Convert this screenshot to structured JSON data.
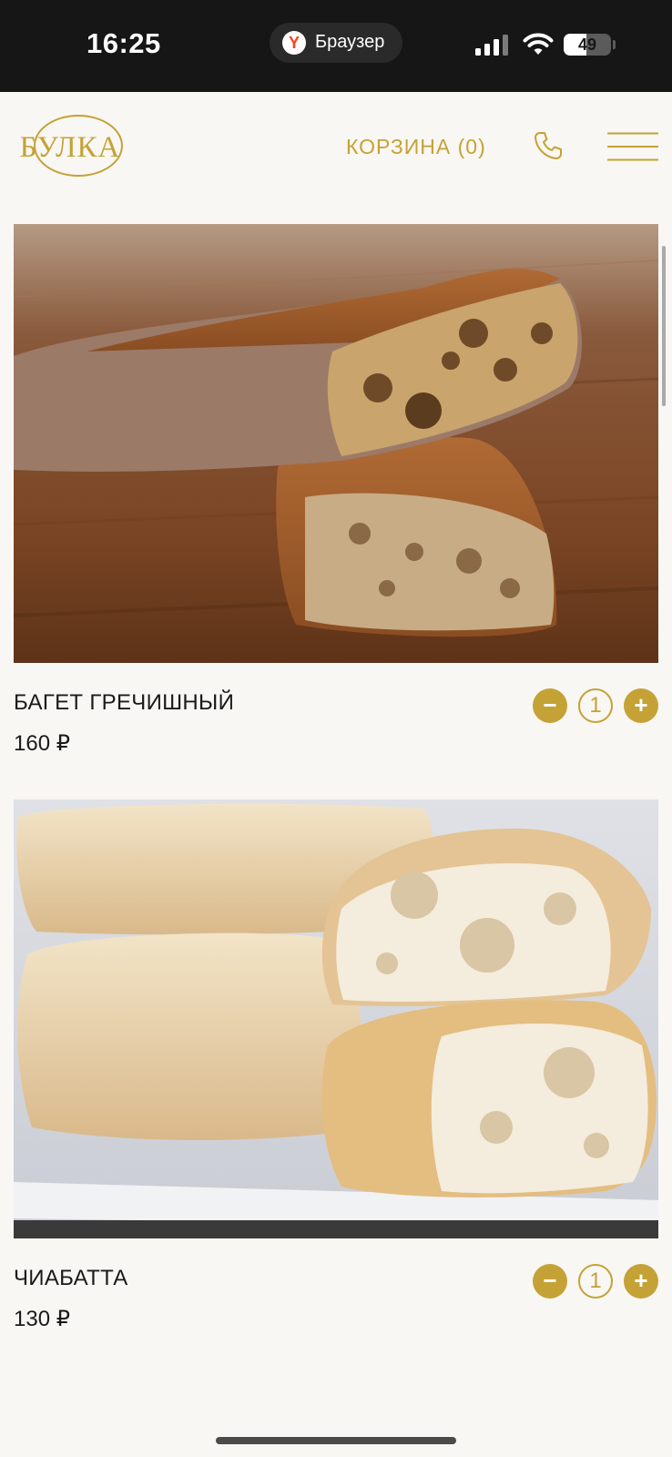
{
  "status_bar": {
    "time": "16:25",
    "browser_name": "Браузер",
    "browser_logo_letter": "Y",
    "battery": "49",
    "battery_level": 0.49,
    "icons": [
      "signal-icon",
      "wifi-icon",
      "battery-icon"
    ]
  },
  "header": {
    "logo_text": "БУЛКА",
    "cart_label": "КОРЗИНА (0)",
    "icons": [
      "phone-icon",
      "menu-icon"
    ]
  },
  "products": [
    {
      "title": "БАГЕТ ГРЕЧИШНЫЙ",
      "price": "160 ₽",
      "quantity": "1",
      "minus": "−",
      "plus": "+"
    },
    {
      "title": "ЧИАБАТТА",
      "price": "130 ₽",
      "quantity": "1",
      "minus": "−",
      "plus": "+"
    }
  ],
  "colors": {
    "accent": "#c4a236",
    "background": "#f9f7f3",
    "status_bar": "#161616",
    "text": "#1a1a1a"
  }
}
